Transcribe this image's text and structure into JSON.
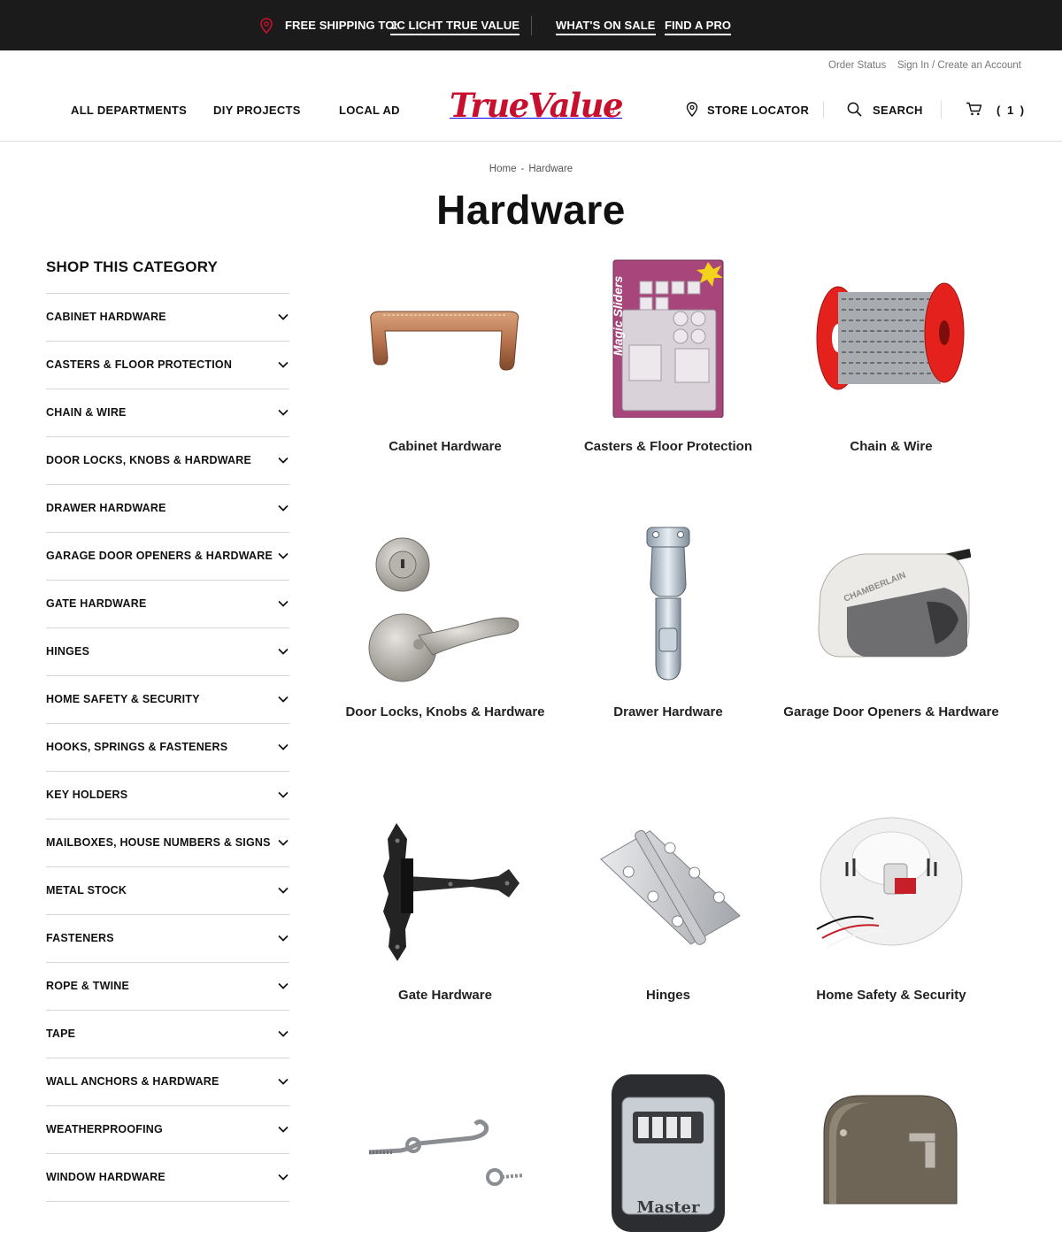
{
  "promo_bar": {
    "ship_label": "FREE SHIPPING TO:",
    "ship_store": "JC LICHT TRUE VALUE",
    "sale_link": "WHAT'S ON SALE",
    "pro_link": "FIND A PRO"
  },
  "header": {
    "order_status": "Order Status",
    "sign_in": "Sign In / Create an Account",
    "nav": [
      "ALL DEPARTMENTS",
      "DIY PROJECTS",
      "LOCAL AD"
    ],
    "logo_text": "TrueValue",
    "store_locator": "STORE LOCATOR",
    "search": "SEARCH",
    "cart_count": "( 1 )"
  },
  "breadcrumb": {
    "home": "Home",
    "separator": "-",
    "current": "Hardware"
  },
  "page_title": "Hardware",
  "sidebar": {
    "title": "SHOP THIS CATEGORY",
    "items": [
      "CABINET HARDWARE",
      "CASTERS & FLOOR PROTECTION",
      "CHAIN & WIRE",
      "DOOR LOCKS, KNOBS & HARDWARE",
      "DRAWER HARDWARE",
      "GARAGE DOOR OPENERS & HARDWARE",
      "GATE HARDWARE",
      "HINGES",
      "HOME SAFETY & SECURITY",
      "HOOKS, SPRINGS & FASTENERS",
      "KEY HOLDERS",
      "MAILBOXES, HOUSE NUMBERS & SIGNS",
      "METAL STOCK",
      "FASTENERS",
      "ROPE & TWINE",
      "TAPE",
      "WALL ANCHORS & HARDWARE",
      "WEATHERPROOFING",
      "WINDOW HARDWARE"
    ]
  },
  "categories": [
    {
      "label": "Cabinet Hardware",
      "icon": "cabinet-pull-icon"
    },
    {
      "label": "Casters & Floor Protection",
      "icon": "felt-pads-icon",
      "package_text": "Magic Sliders"
    },
    {
      "label": "Chain & Wire",
      "icon": "chain-spool-icon"
    },
    {
      "label": "Door Locks, Knobs & Hardware",
      "icon": "door-lock-icon"
    },
    {
      "label": "Drawer Hardware",
      "icon": "latch-icon"
    },
    {
      "label": "Garage Door Openers & Hardware",
      "icon": "garage-opener-icon",
      "brand_text": "CHAMBERLAIN"
    },
    {
      "label": "Gate Hardware",
      "icon": "t-hinge-icon"
    },
    {
      "label": "Hinges",
      "icon": "butt-hinge-icon"
    },
    {
      "label": "Home Safety & Security",
      "icon": "smoke-detector-icon"
    },
    {
      "label": "",
      "icon": "hook-eye-icon"
    },
    {
      "label": "",
      "icon": "lock-box-icon",
      "brand_text": "Master"
    },
    {
      "label": "",
      "icon": "mailbox-icon"
    }
  ],
  "colors": {
    "promo_bg": "#1b1b1b",
    "brand_red": "#c8102e",
    "text": "#111111",
    "divider": "#d6d6d6"
  }
}
